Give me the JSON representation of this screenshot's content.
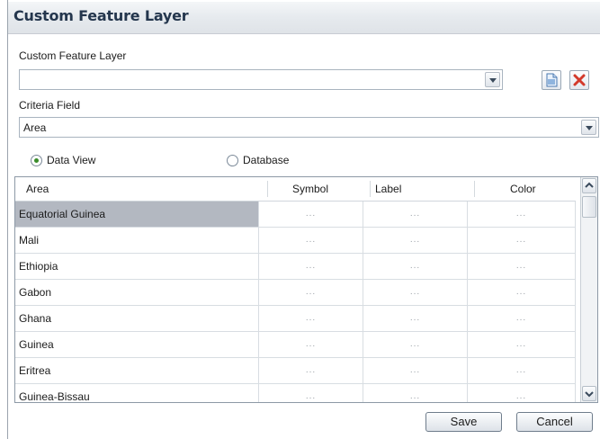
{
  "window": {
    "title": "Custom Feature Layer"
  },
  "layer": {
    "label": "Custom Feature Layer",
    "value": "",
    "new_icon": "new-document-icon",
    "delete_icon": "delete-x-icon"
  },
  "criteria": {
    "label": "Criteria Field",
    "value": "Area"
  },
  "source": {
    "options": [
      {
        "label": "Data View",
        "selected": true
      },
      {
        "label": "Database",
        "selected": false
      }
    ]
  },
  "table": {
    "columns": [
      "Area",
      "Symbol",
      "Label",
      "Color"
    ],
    "ellipsis": "...",
    "rows": [
      {
        "area": "Equatorial Guinea",
        "selected": true
      },
      {
        "area": "Mali"
      },
      {
        "area": "Ethiopia"
      },
      {
        "area": "Gabon"
      },
      {
        "area": "Ghana"
      },
      {
        "area": "Guinea"
      },
      {
        "area": "Eritrea"
      },
      {
        "area": "Guinea-Bissau"
      }
    ]
  },
  "buttons": {
    "save": "Save",
    "cancel": "Cancel"
  },
  "colors": {
    "selected_row": "#b3b8c1",
    "title_text": "#24364d",
    "delete_red": "#d33a2c"
  }
}
